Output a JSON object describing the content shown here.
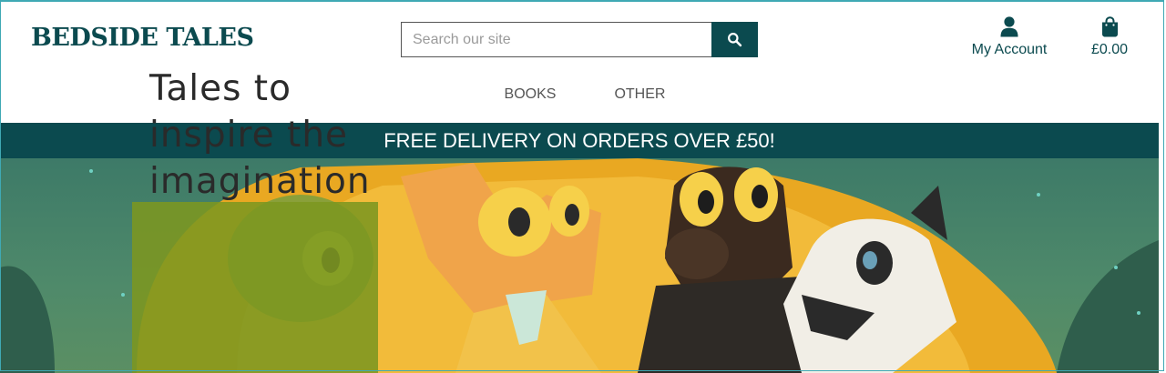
{
  "brand": {
    "logo_text": "BEDSIDE TALES",
    "primary_color": "#0b4a4f"
  },
  "search": {
    "placeholder": "Search our site",
    "value": "",
    "button_icon": "search-icon"
  },
  "header_actions": {
    "account": {
      "label": "My Account",
      "icon": "user-icon"
    },
    "cart": {
      "label": "£0.00",
      "icon": "shopping-bag-icon"
    }
  },
  "nav": {
    "items": [
      {
        "label": "BOOKS"
      },
      {
        "label": "OTHER"
      }
    ]
  },
  "banner": {
    "text": "FREE DELIVERY ON ORDERS OVER £50!"
  },
  "hero": {
    "title_lines": [
      "Tales to",
      "inspire the",
      "imagination"
    ],
    "image": "illustration of cartoon animal characters in a tent"
  }
}
